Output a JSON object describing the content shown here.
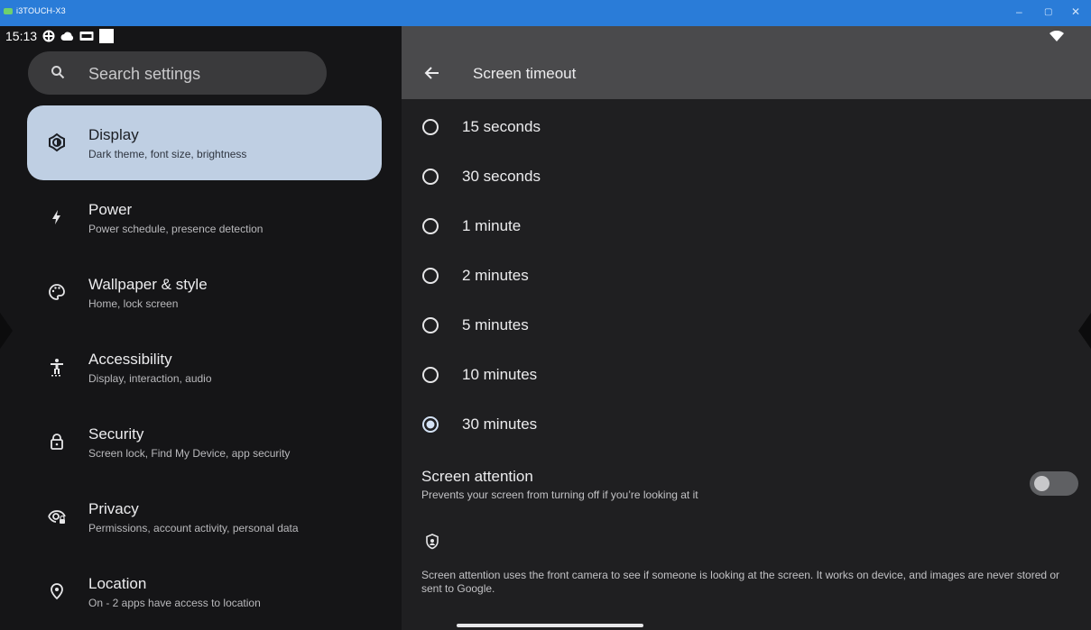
{
  "window": {
    "title": "i3TOUCH-X3",
    "minimize": "–",
    "maximize": "▢",
    "close": "✕"
  },
  "status": {
    "time": "15:13"
  },
  "search": {
    "placeholder": "Search settings"
  },
  "sidebar": {
    "items": [
      {
        "title": "Display",
        "subtitle": "Dark theme, font size, brightness",
        "icon": "brightness-icon",
        "active": true
      },
      {
        "title": "Power",
        "subtitle": "Power schedule, presence detection",
        "icon": "bolt-icon"
      },
      {
        "title": "Wallpaper & style",
        "subtitle": "Home, lock screen",
        "icon": "palette-icon"
      },
      {
        "title": "Accessibility",
        "subtitle": "Display, interaction, audio",
        "icon": "accessibility-icon"
      },
      {
        "title": "Security",
        "subtitle": "Screen lock, Find My Device, app security",
        "icon": "lock-icon"
      },
      {
        "title": "Privacy",
        "subtitle": "Permissions, account activity, personal data",
        "icon": "privacy-icon"
      },
      {
        "title": "Location",
        "subtitle": "On - 2 apps have access to location",
        "icon": "location-pin-icon"
      }
    ]
  },
  "page": {
    "title": "Screen timeout",
    "options": [
      {
        "label": "15 seconds",
        "selected": false
      },
      {
        "label": "30 seconds",
        "selected": false
      },
      {
        "label": "1 minute",
        "selected": false
      },
      {
        "label": "2 minutes",
        "selected": false
      },
      {
        "label": "5 minutes",
        "selected": false
      },
      {
        "label": "10 minutes",
        "selected": false
      },
      {
        "label": "30 minutes",
        "selected": true
      }
    ],
    "attention": {
      "title": "Screen attention",
      "subtitle": "Prevents your screen from turning off if you’re looking at it",
      "enabled": false
    },
    "footnote": "Screen attention uses the front camera to see if someone is looking at the screen. It works on device, and images are never stored or sent to Google."
  },
  "colors": {
    "accent": "#bfcfe3",
    "titlebar": "#2a7cd8"
  }
}
